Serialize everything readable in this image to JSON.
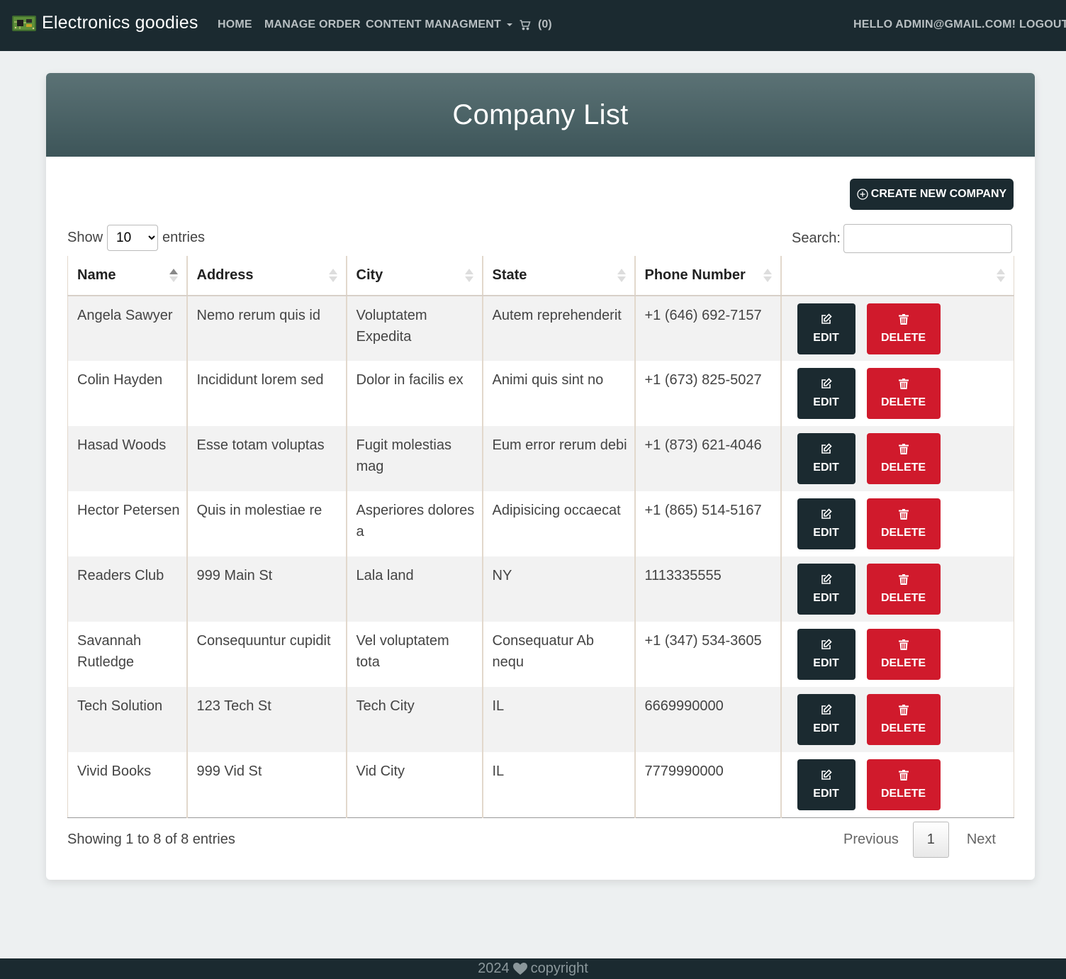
{
  "nav": {
    "brand": "Electronics goodies",
    "home": "HOME",
    "manage_order": "MANAGE ORDER",
    "content_management": "CONTENT MANAGMENT",
    "cart_count": "(0)",
    "hello": "HELLO ADMIN@GMAIL.COM!",
    "logout": "LOGOUT"
  },
  "page": {
    "title": "Company List",
    "create_button": "CREATE NEW COMPANY",
    "show_label": "Show",
    "entries_label": "entries",
    "length_value": "10",
    "search_label": "Search:",
    "search_value": ""
  },
  "table": {
    "columns": [
      "Name",
      "Address",
      "City",
      "State",
      "Phone Number",
      ""
    ],
    "sorted_column": "Name",
    "rows": [
      {
        "name": "Angela Sawyer",
        "address": "Nemo rerum quis id",
        "city": "Voluptatem Expedita",
        "state": "Autem reprehenderit",
        "phone": "+1 (646) 692-7157"
      },
      {
        "name": "Colin Hayden",
        "address": "Incididunt lorem sed",
        "city": "Dolor in facilis ex",
        "state": "Animi quis sint no",
        "phone": "+1 (673) 825-5027"
      },
      {
        "name": "Hasad Woods",
        "address": "Esse totam voluptas",
        "city": "Fugit molestias mag",
        "state": "Eum error rerum debi",
        "phone": "+1 (873) 621-4046"
      },
      {
        "name": "Hector Petersen",
        "address": "Quis in molestiae re",
        "city": "Asperiores dolores a",
        "state": "Adipisicing occaecat",
        "phone": "+1 (865) 514-5167"
      },
      {
        "name": "Readers Club",
        "address": "999 Main St",
        "city": "Lala land",
        "state": "NY",
        "phone": "1113335555"
      },
      {
        "name": "Savannah Rutledge",
        "address": "Consequuntur cupidit",
        "city": "Vel voluptatem tota",
        "state": "Consequatur Ab nequ",
        "phone": "+1 (347) 534-3605"
      },
      {
        "name": "Tech Solution",
        "address": "123 Tech St",
        "city": "Tech City",
        "state": "IL",
        "phone": "6669990000"
      },
      {
        "name": "Vivid Books",
        "address": "999 Vid St",
        "city": "Vid City",
        "state": "IL",
        "phone": "7779990000"
      }
    ],
    "edit_label": "EDIT",
    "delete_label": "DELETE"
  },
  "pagination": {
    "info": "Showing 1 to 8 of 8 entries",
    "previous": "Previous",
    "current": "1",
    "next": "Next"
  },
  "footer": {
    "year": "2024",
    "text": "copyright"
  },
  "colors": {
    "navbar": "#1b2a30",
    "header_top": "#5b7275",
    "header_bottom": "#3d5559",
    "delete": "#d01a2c",
    "background": "#edf0f1"
  },
  "icons": {
    "brand": "circuit-board-icon",
    "cart": "shopping-cart-icon",
    "create": "plus-circle-icon",
    "edit": "pencil-square-icon",
    "delete": "trash-icon",
    "footer": "heart-icon"
  }
}
